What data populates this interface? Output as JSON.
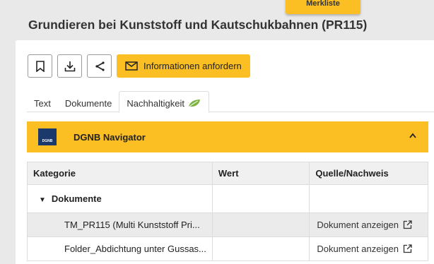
{
  "header": {
    "merkliste_label": "Merkliste",
    "title": "Grundieren bei Kunststoff und Kautschukbahnen (PR115)"
  },
  "toolbar": {
    "info_button_label": "Informationen anfordern"
  },
  "tabs": [
    {
      "label": "Text"
    },
    {
      "label": "Dokumente"
    },
    {
      "label": "Nachhaltigkeit",
      "active": true
    }
  ],
  "dgnb": {
    "logo_text": "DGNB",
    "title": "DGNB Navigator"
  },
  "table": {
    "headers": [
      "Kategorie",
      "Wert",
      "Quelle/Nachweis"
    ],
    "group_label": "Dokumente",
    "rows": [
      {
        "name": "TM_PR115 (Multi Kunststoff Pri...",
        "value": "",
        "link": "Dokument anzeigen"
      },
      {
        "name": "Folder_Abdichtung unter Gussas...",
        "value": "",
        "link": "Dokument anzeigen"
      }
    ]
  },
  "colors": {
    "accent": "#fbbf24",
    "background": "#e9e9e9",
    "leaf": "#7cb342"
  }
}
